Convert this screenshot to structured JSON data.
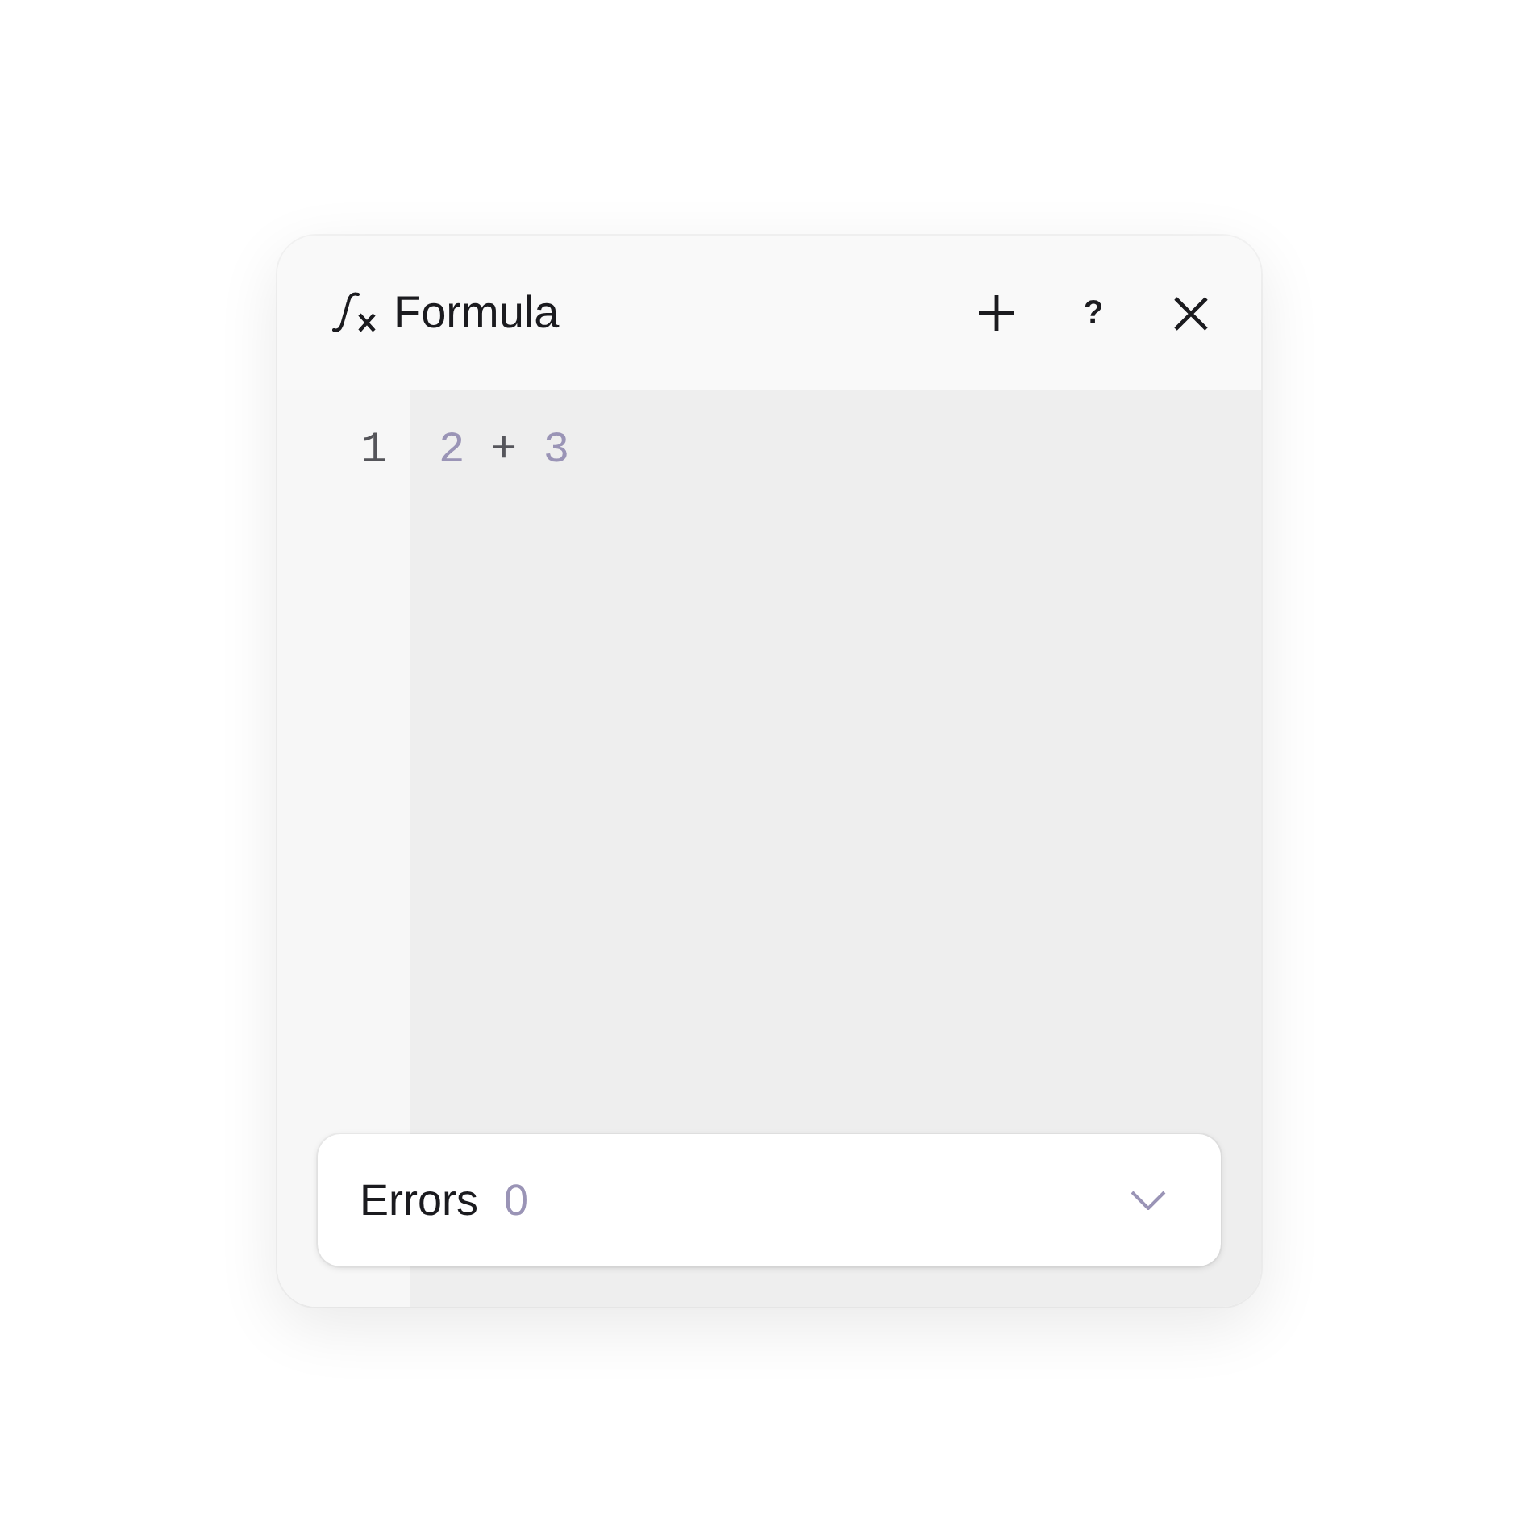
{
  "panel": {
    "title": "Formula",
    "actions": [
      {
        "kind": "add"
      },
      {
        "kind": "help",
        "label": "?"
      },
      {
        "kind": "close"
      }
    ]
  },
  "editor": {
    "lines": [
      {
        "number": "1",
        "tokens": [
          {
            "kind": "number",
            "text": "2"
          },
          {
            "kind": "operator",
            "text": "+"
          },
          {
            "kind": "number",
            "text": "3"
          }
        ]
      }
    ]
  },
  "errors": {
    "label": "Errors",
    "count": "0",
    "expanded": false
  }
}
